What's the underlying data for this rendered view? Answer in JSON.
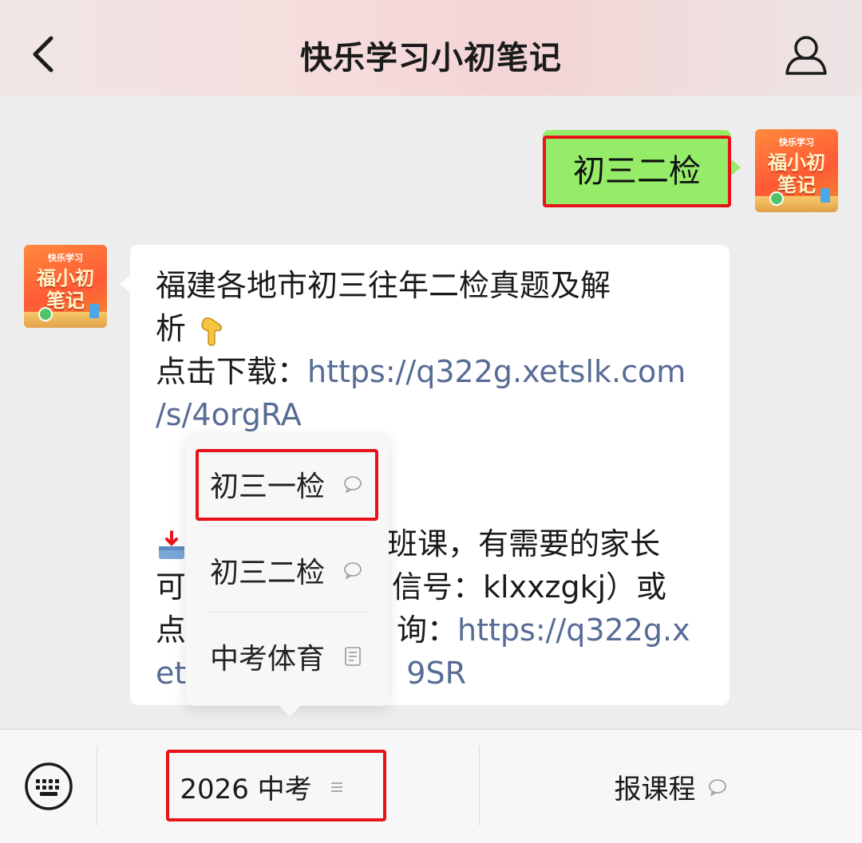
{
  "header": {
    "title": "快乐学习小初笔记",
    "back_icon": "chevron-left-icon",
    "profile_icon": "person-icon"
  },
  "avatar": {
    "small_text": "快乐学习",
    "line1": "福小初",
    "line2": "笔记"
  },
  "sent_message": {
    "text": "初三二检"
  },
  "received_message": {
    "line1": "福建各地市初三往年二检真题及解",
    "line2_text": "析",
    "line2_emoji": "pointing-down-hand-icon",
    "download_label": "点击下载：",
    "download_link_part1": "https://q322g.xetslk.com",
    "download_link_part2": "/s/4orgRA",
    "visible_line5_start_emoji": "inbox-tray-icon",
    "visible_line5_end": "班课，有需要的家长",
    "visible_line6_start": "可",
    "visible_line6_end": "信号：klxxzgkj）或",
    "visible_line7_start": "点",
    "visible_line7_mid": "询：",
    "visible_line7_link": "https://q322g.x",
    "visible_line8_start": "et",
    "visible_line8_end": "9SR"
  },
  "popup_menu": {
    "items": [
      {
        "label": "初三一检",
        "icon": "chat-bubble-icon"
      },
      {
        "label": "初三二检",
        "icon": "chat-bubble-icon"
      },
      {
        "label": "中考体育",
        "icon": "document-icon"
      }
    ]
  },
  "bottom_bar": {
    "keyboard_icon": "keyboard-icon",
    "menu_main_label": "2026 中考",
    "menu_main_icon": "menu-lines-icon",
    "menu_course_label": "报课程",
    "menu_course_icon": "chat-bubble-icon"
  },
  "colors": {
    "sent_bubble": "#95ec69",
    "link": "#576b95",
    "highlight": "#e8121b",
    "background": "#ededed"
  }
}
